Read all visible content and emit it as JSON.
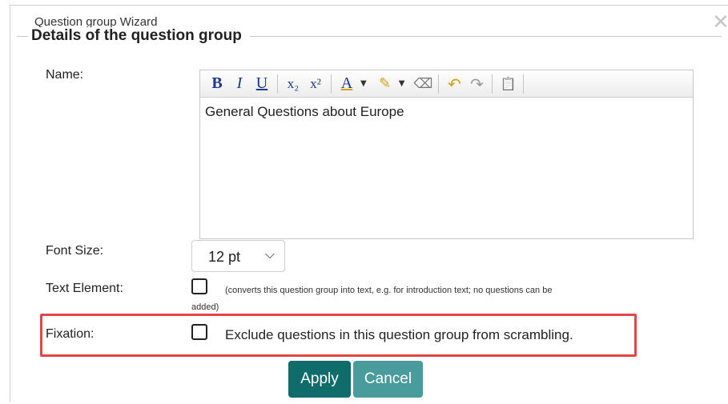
{
  "dialog": {
    "title": "Question group Wizard",
    "close_glyph": "✕"
  },
  "section": {
    "legend": "Details of the question group"
  },
  "name": {
    "label": "Name:",
    "value": "General Questions about Europe"
  },
  "toolbar": {
    "buttons": [
      {
        "name": "bold-icon",
        "glyph": "B"
      },
      {
        "name": "italic-icon",
        "glyph": "I"
      },
      {
        "name": "underline-icon",
        "glyph": "U"
      },
      {
        "name": "subscript-icon",
        "glyph": "x₂"
      },
      {
        "name": "superscript-icon",
        "glyph": "x²"
      },
      {
        "name": "text-color-icon",
        "glyph": "A"
      },
      {
        "name": "highlight-color-icon",
        "glyph": "✎"
      },
      {
        "name": "remove-format-icon",
        "glyph": "⌫"
      },
      {
        "name": "undo-icon",
        "glyph": "↶"
      },
      {
        "name": "redo-icon",
        "glyph": "↷"
      },
      {
        "name": "paste-icon",
        "glyph": "📋"
      }
    ],
    "caret": "▼"
  },
  "font_size": {
    "label": "Font Size:",
    "selected": "12 pt",
    "chevron": "⌵"
  },
  "text_element": {
    "label": "Text Element:",
    "note_line1": "(converts this question group into text, e.g. for introduction text; no questions can be",
    "note_line2": "added)"
  },
  "fixation": {
    "label": "Fixation:",
    "text": "Exclude questions in this question group from scrambling."
  },
  "actions": {
    "apply": "Apply",
    "cancel": "Cancel"
  },
  "colors": {
    "apply_bg": "#106b6b",
    "cancel_bg": "#4a9b9b",
    "highlight_border": "#e0474c"
  }
}
